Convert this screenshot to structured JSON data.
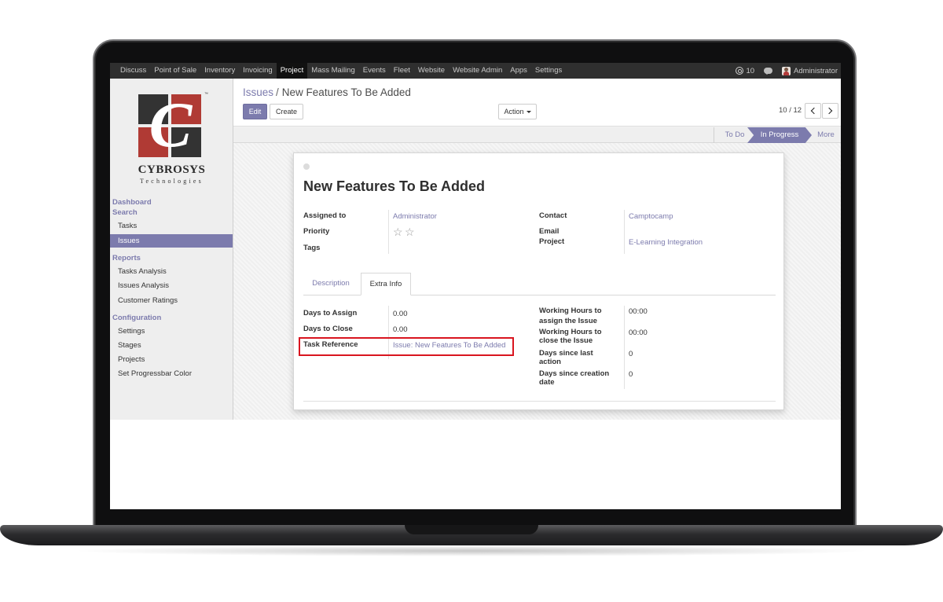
{
  "topbar": {
    "menu": [
      "Discuss",
      "Point of Sale",
      "Inventory",
      "Invoicing",
      "Project",
      "Mass Mailing",
      "Events",
      "Fleet",
      "Website",
      "Website Admin",
      "Apps",
      "Settings"
    ],
    "active_menu": "Project",
    "mentions_count": "10",
    "user_name": "Administrator"
  },
  "logo": {
    "letter": "C",
    "name": "CYBROSYS",
    "subtitle": "Technologies",
    "tm": "™"
  },
  "sidebar": {
    "dashboard": "Dashboard",
    "search": "Search",
    "search_items": [
      "Tasks",
      "Issues"
    ],
    "active_item": "Issues",
    "reports": "Reports",
    "report_items": [
      "Tasks Analysis",
      "Issues Analysis",
      "Customer Ratings"
    ],
    "configuration": "Configuration",
    "config_items": [
      "Settings",
      "Stages",
      "Projects",
      "Set Progressbar Color"
    ]
  },
  "breadcrumb": {
    "parent": "Issues",
    "separator": "/",
    "current": "New Features To Be Added"
  },
  "buttons": {
    "edit": "Edit",
    "create": "Create",
    "action": "Action"
  },
  "pager": {
    "text": "10 / 12"
  },
  "stages": {
    "todo": "To Do",
    "active": "In Progress",
    "more": "More"
  },
  "form": {
    "title": "New Features To Be Added",
    "assigned_to_label": "Assigned to",
    "assigned_to_value": "Administrator",
    "priority_label": "Priority",
    "priority_stars": 0,
    "priority_max": 2,
    "tags_label": "Tags",
    "contact_label": "Contact",
    "contact_value": "Camptocamp",
    "email_label": "Email",
    "project_label": "Project",
    "project_value": "E-Learning Integration"
  },
  "tabs": {
    "description": "Description",
    "extra_info": "Extra Info",
    "active": "Extra Info"
  },
  "extra_info": {
    "days_to_assign_label": "Days to Assign",
    "days_to_assign_value": "0.00",
    "days_to_close_label": "Days to Close",
    "days_to_close_value": "0.00",
    "task_reference_label": "Task Reference",
    "task_reference_value": "Issue: New Features To Be Added",
    "wh_assign_label_1": "Working Hours to",
    "wh_assign_label_2": "assign the Issue",
    "wh_assign_value": "00:00",
    "wh_close_label_1": "Working Hours to",
    "wh_close_label_2": "close the Issue",
    "wh_close_value": "00:00",
    "days_last_action_label_1": "Days since last",
    "days_last_action_label_2": "action",
    "days_last_action_value": "0",
    "days_creation_label_1": "Days since creation",
    "days_creation_label_2": "date",
    "days_creation_value": "0"
  },
  "colors": {
    "accent": "#7c7bad",
    "topbar": "#2f2f2f",
    "highlight": "#d9151f",
    "logo_red": "#b03a34",
    "logo_dark": "#333333"
  }
}
